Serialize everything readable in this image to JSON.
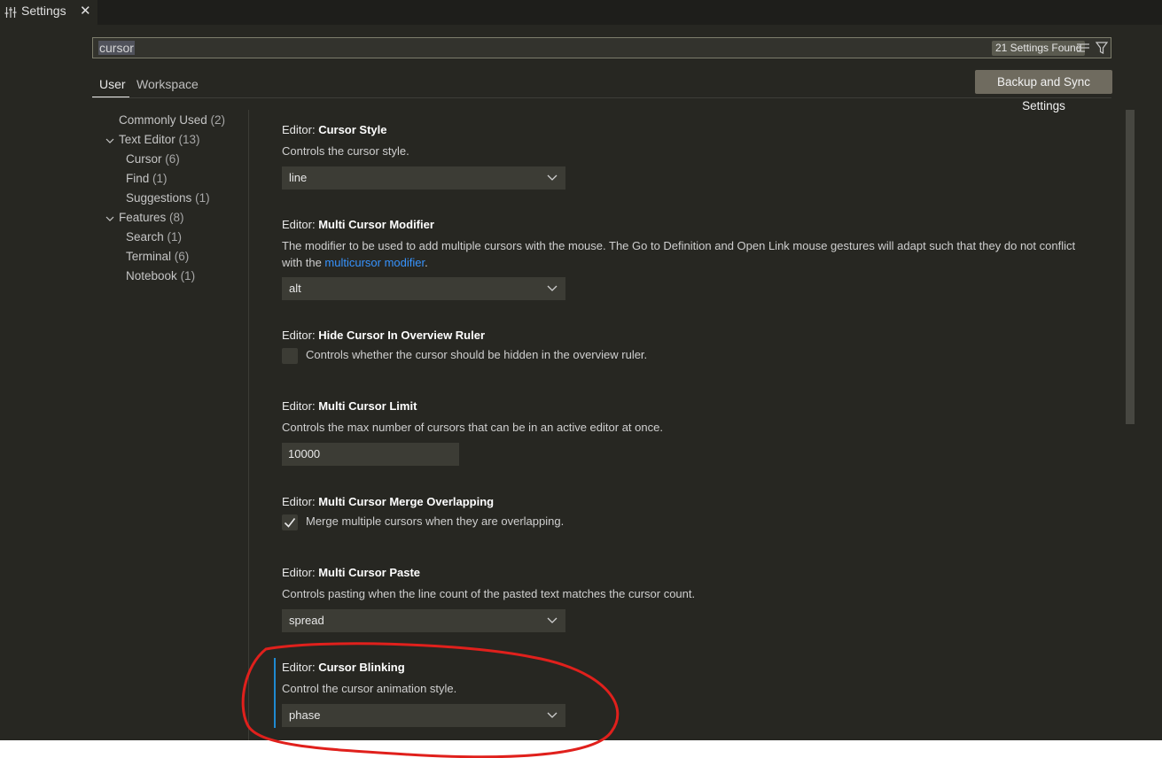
{
  "tab": {
    "title": "Settings"
  },
  "search": {
    "value": "cursor",
    "results_badge": "21 Settings Found"
  },
  "scopes": [
    {
      "label": "User",
      "active": true
    },
    {
      "label": "Workspace",
      "active": false
    }
  ],
  "sync_button": "Backup and Sync Settings",
  "toc": [
    {
      "label": "Commonly Used",
      "count": "(2)"
    },
    {
      "label": "Text Editor",
      "count": "(13)"
    },
    {
      "label": "Cursor",
      "count": "(6)"
    },
    {
      "label": "Find",
      "count": "(1)"
    },
    {
      "label": "Suggestions",
      "count": "(1)"
    },
    {
      "label": "Features",
      "count": "(8)"
    },
    {
      "label": "Search",
      "count": "(1)"
    },
    {
      "label": "Terminal",
      "count": "(6)"
    },
    {
      "label": "Notebook",
      "count": "(1)"
    }
  ],
  "settings": [
    {
      "category": "Editor: ",
      "name": "Cursor Style",
      "description": "Controls the cursor style.",
      "value": "line"
    },
    {
      "category": "Editor: ",
      "name": "Multi Cursor Modifier",
      "description": "The modifier to be used to add multiple cursors with the mouse. The Go to Definition and Open Link mouse gestures will adapt such that they do not conflict",
      "description_line2_prefix": "with the ",
      "link": "multicursor modifier",
      "description_line2_suffix": ".",
      "value": "alt"
    },
    {
      "category": "Editor: ",
      "name": "Hide Cursor In Overview Ruler",
      "description": "Controls whether the cursor should be hidden in the overview ruler.",
      "checked": false
    },
    {
      "category": "Editor: ",
      "name": "Multi Cursor Limit",
      "description": "Controls the max number of cursors that can be in an active editor at once.",
      "value": "10000"
    },
    {
      "category": "Editor: ",
      "name": "Multi Cursor Merge Overlapping",
      "description": "Merge multiple cursors when they are overlapping.",
      "checked": true
    },
    {
      "category": "Editor: ",
      "name": "Multi Cursor Paste",
      "description": "Controls pasting when the line count of the pasted text matches the cursor count.",
      "value": "spread"
    },
    {
      "category": "Editor: ",
      "name": "Cursor Blinking",
      "description": "Control the cursor animation style.",
      "value": "phase"
    }
  ],
  "colors": {
    "background": "#272722",
    "accent_link": "#3794ff",
    "focus_bar": "#1f8ad2",
    "annotation": "#e0201c"
  }
}
